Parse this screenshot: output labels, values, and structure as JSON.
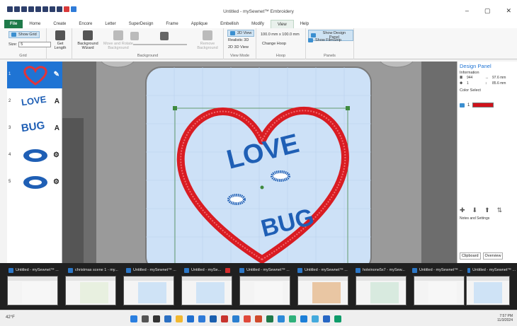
{
  "window": {
    "title": "Untitled - mySewnet™ Embroidery",
    "min": "–",
    "max": "▢",
    "close": "✕"
  },
  "menu": [
    "Home",
    "Create",
    "Encore",
    "Letter",
    "SuperDesign",
    "Frame",
    "Applique",
    "Embellish",
    "Modify",
    "View",
    "Help"
  ],
  "menu_file": "File",
  "menu_active": "View",
  "ribbon": {
    "grid": {
      "show_grid": "Show Grid",
      "size_label": "Size:",
      "size_value": "5",
      "group": "Grid",
      "get_length": "Get Length"
    },
    "background": {
      "wizard": "Background Wizard",
      "move_rotate": "Move and Rotate Background",
      "remove": "Remove Background",
      "group": "Background"
    },
    "viewmode": {
      "v2d": "2D View",
      "realistic": "Realistic 3D",
      "v3d": "2D 3D View",
      "group": "View Mode"
    },
    "hoop": {
      "size": "100.0 mm x 100.0 mm",
      "change": "Change Hoop",
      "group": "Hoop"
    },
    "panels": {
      "design": "Show Design Panel",
      "filmstrip": "Show FilmStrip",
      "group": "Panels"
    }
  },
  "objects": [
    {
      "num": "1",
      "icon": "✎",
      "selected": true
    },
    {
      "num": "2",
      "text": "LOVE",
      "icon": "A",
      "selected": false
    },
    {
      "num": "3",
      "text": "BUG",
      "icon": "A",
      "selected": false
    },
    {
      "num": "4",
      "icon": "⚙",
      "selected": false
    },
    {
      "num": "5",
      "icon": "⚙",
      "selected": false
    }
  ],
  "canvas": {
    "word1": "LOVE",
    "word2": "BUG"
  },
  "design_panel": {
    "title": "Design Panel",
    "info_label": "Information",
    "stitches": "944",
    "colors": "1",
    "width": "97.6 mm",
    "height": "85.6 mm",
    "color_select": "Color Select",
    "color_num": "1",
    "notes": "Notes and Settings",
    "tabs": [
      "Clipboard",
      "Overview"
    ]
  },
  "taskgroup": [
    "Untitled - mySewnet™ ...",
    "christmas scene 1 - my...",
    "Untitled - mySewnet™ ...",
    "Untitled - mySe...",
    "Untitled - mySewnet™ ...",
    "Untitled - mySewnet™ ...",
    "holeinone5x7 - mySew...",
    "Untitled - mySewnet™ ...",
    "Untitled - mySewnet™ ..."
  ],
  "weather": "42°F",
  "clock": {
    "time": "7:57 PM",
    "date": "11/3/2024"
  },
  "colors": {
    "accent": "#1f7a4a",
    "selection": "#1f74d4",
    "thread": "#d1121b",
    "text_blue": "#1f5fb5"
  }
}
